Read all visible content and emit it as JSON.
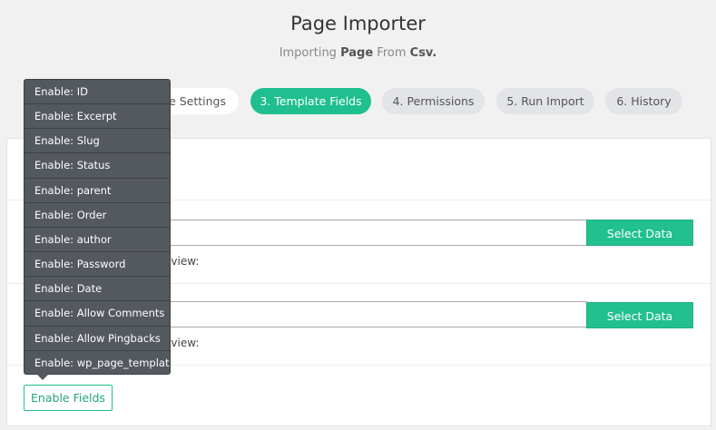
{
  "header": {
    "title": "Page Importer",
    "subtitle_prefix": "Importing",
    "subtitle_type": "Page",
    "subtitle_mid": "From",
    "subtitle_source": "Csv."
  },
  "steps": [
    {
      "label": "le Settings"
    },
    {
      "label": "3. Template Fields"
    },
    {
      "label": "4. Permissions"
    },
    {
      "label": "5. Run Import"
    },
    {
      "label": "6. History"
    }
  ],
  "fields": [
    {
      "select_label": "Select Data",
      "preview_label": "eview:"
    },
    {
      "select_label": "Select Data",
      "preview_label": "eview:"
    }
  ],
  "enable_button": "Enable Fields",
  "dropdown_items": [
    "Enable: ID",
    "Enable: Excerpt",
    "Enable: Slug",
    "Enable: Status",
    "Enable: parent",
    "Enable: Order",
    "Enable: author",
    "Enable: Password",
    "Enable: Date",
    "Enable: Allow Comments",
    "Enable: Allow Pingbacks",
    "Enable: wp_page_template"
  ],
  "colors": {
    "accent": "#22c08f",
    "dropdown_bg": "#54585f",
    "page_bg": "#f1f1f1"
  }
}
